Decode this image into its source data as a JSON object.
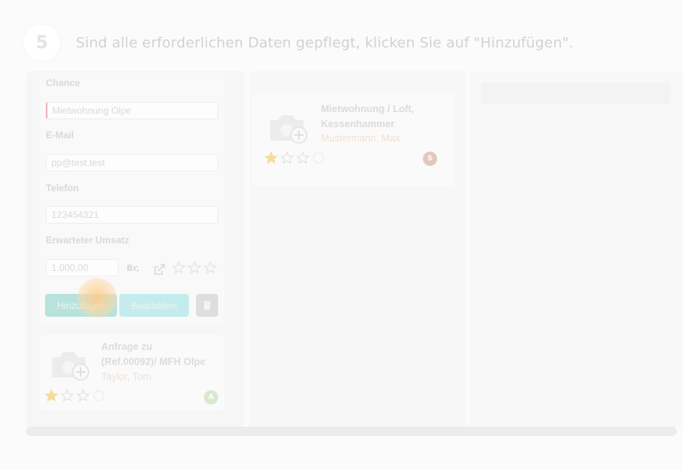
{
  "step": {
    "number": "5",
    "text": "Sind alle erforderlichen Daten gepflegt, klicken Sie auf \"Hinzufügen\"."
  },
  "form": {
    "chance_label": "Chance",
    "chance_value": "Mietwohnung Olpe",
    "email_label": "E-Mail",
    "email_value": "pp@test.test",
    "phone_label": "Telefon",
    "phone_value": "123454321",
    "revenue_label": "Erwarteter Umsatz",
    "revenue_value": "1.000,00",
    "revenue_unit": "Br,",
    "rating": 0,
    "add_label": "Hinzufügen",
    "edit_label": "Bearbeiten"
  },
  "cards": [
    {
      "title_line1": "Anfrage zu",
      "title_line2": "(Ref.00092)/ MFH Olpe",
      "person": "Taylor, Tom",
      "rating": 1,
      "avatar": "A"
    },
    {
      "title_line1": "Mietwohnung / Loft,",
      "title_line2": "Kessenhammer",
      "person": "Mustermann, Max",
      "rating": 1,
      "avatar": "S"
    }
  ],
  "colors": {
    "add_button": "#b8e3dd",
    "edit_button": "#c4ecec",
    "star_filled": "#f6dc9a",
    "star_empty": "#e3e3e3",
    "click_marker": "#fdcd8c"
  },
  "icons": [
    "camera-add-icon",
    "star-icon",
    "external-link-icon",
    "trash-icon",
    "smiley-icon"
  ]
}
